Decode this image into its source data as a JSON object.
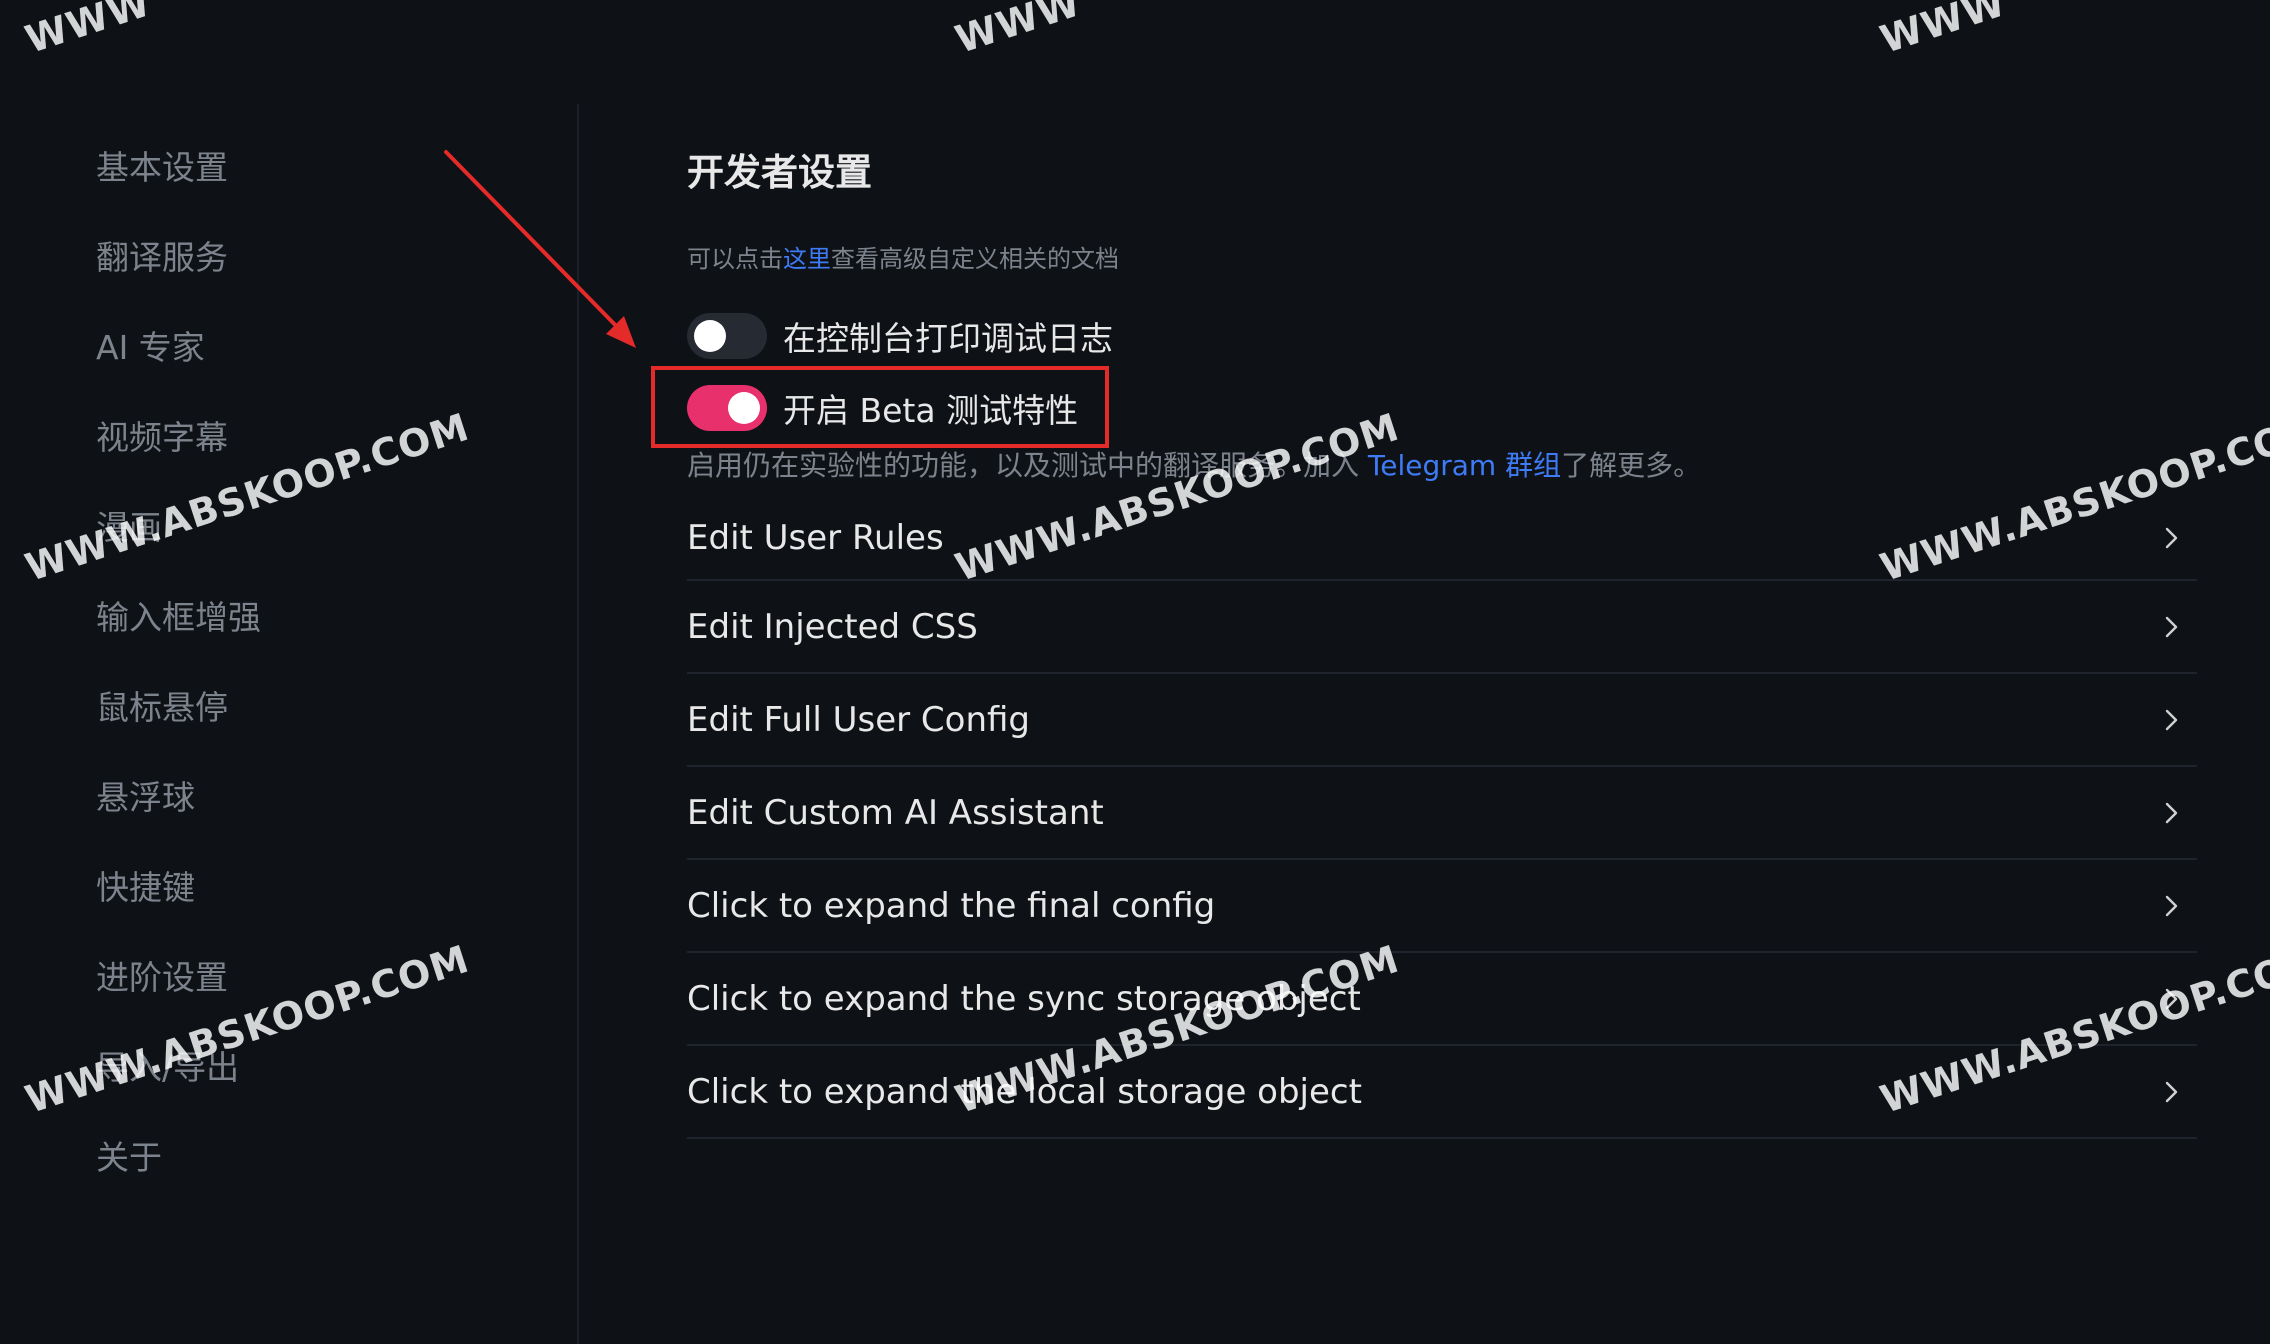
{
  "sidebar": {
    "items": [
      {
        "label": "基本设置"
      },
      {
        "label": "翻译服务"
      },
      {
        "label": "AI 专家"
      },
      {
        "label": "视频字幕"
      },
      {
        "label": "漫画"
      },
      {
        "label": "输入框增强"
      },
      {
        "label": "鼠标悬停"
      },
      {
        "label": "悬浮球"
      },
      {
        "label": "快捷键"
      },
      {
        "label": "进阶设置"
      },
      {
        "label": "导入/导出"
      },
      {
        "label": "关于"
      }
    ]
  },
  "main": {
    "title": "开发者设置",
    "doc_hint": {
      "prefix": "可以点击",
      "link": "这里",
      "suffix": "查看高级自定义相关的文档"
    },
    "toggles": [
      {
        "label": "在控制台打印调试日志",
        "state": "off"
      },
      {
        "label": "开启 Beta 测试特性",
        "state": "on"
      }
    ],
    "beta_description": {
      "prefix": "启用仍在实验性的功能，以及测试中的翻译服务。加入 ",
      "link": "Telegram 群组",
      "suffix": "了解更多。"
    },
    "rows": [
      {
        "label": "Edit User Rules"
      },
      {
        "label": "Edit Injected CSS"
      },
      {
        "label": "Edit Full User Config"
      },
      {
        "label": "Edit Custom AI Assistant"
      },
      {
        "label": "Click to expand the final config"
      },
      {
        "label": "Click to expand the sync storage object"
      },
      {
        "label": "Click to expand the local storage object"
      }
    ]
  },
  "watermark": {
    "text": "WWW.ABSKOOP.COM",
    "partial_text": "WWW"
  },
  "colors": {
    "background": "#0e1116",
    "accent_link": "#3e7bf5",
    "toggle_on": "#e8306d",
    "annotation_red": "#e52a2a"
  }
}
